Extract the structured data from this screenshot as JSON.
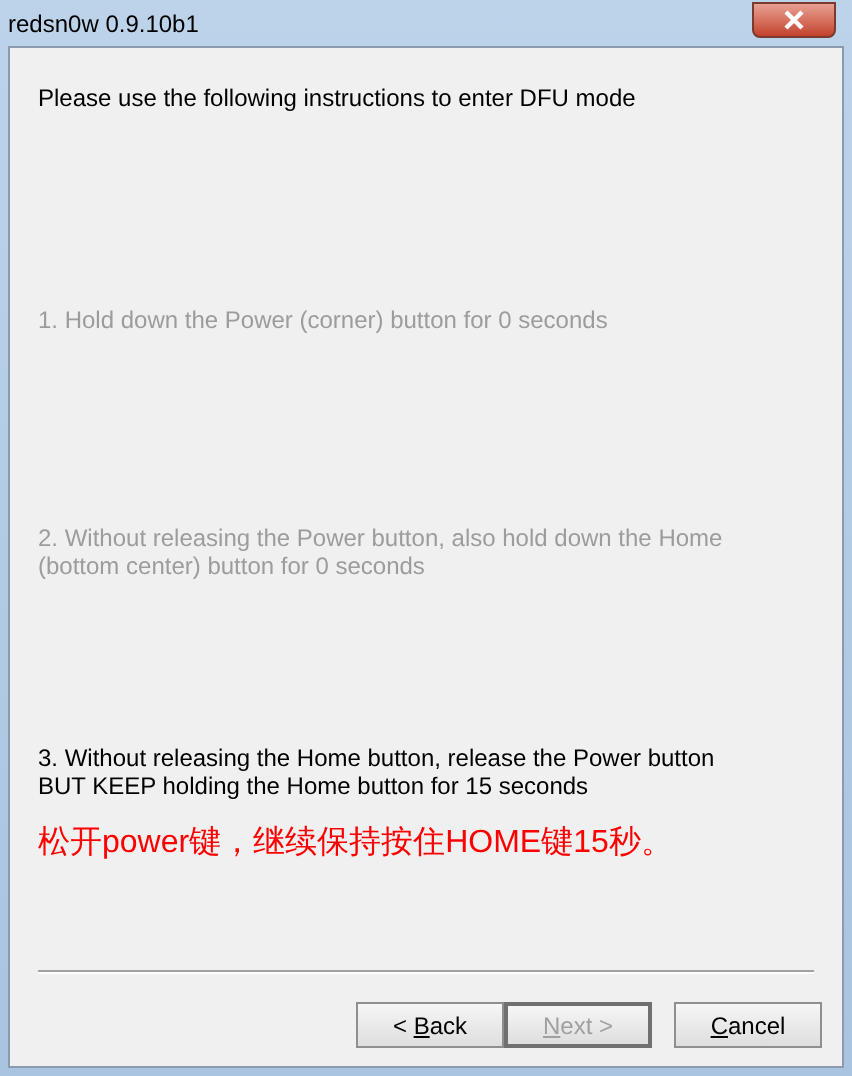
{
  "window": {
    "title": "redsn0w 0.9.10b1"
  },
  "heading": "Please use the following instructions to enter DFU mode",
  "steps": [
    {
      "text": "1. Hold down the Power (corner) button for 0 seconds",
      "active": false
    },
    {
      "text": "2. Without releasing the Power button, also hold down the Home (bottom center) button for 0 seconds",
      "active": false
    },
    {
      "text": "3. Without releasing the Home button, release the Power button BUT KEEP holding the Home button for 15 seconds",
      "active": true
    }
  ],
  "note": {
    "text": "松开power键，继续保持按住HOME键15秒。",
    "color": "#ff0000"
  },
  "buttons": [
    {
      "before": "< ",
      "accel": "B",
      "after": "ack",
      "disabled": false,
      "focused": false
    },
    {
      "accel": "N",
      "after": "ext >",
      "disabled": true,
      "focused": true
    },
    {
      "accel": "C",
      "after": "ancel",
      "disabled": false,
      "focused": false
    }
  ]
}
